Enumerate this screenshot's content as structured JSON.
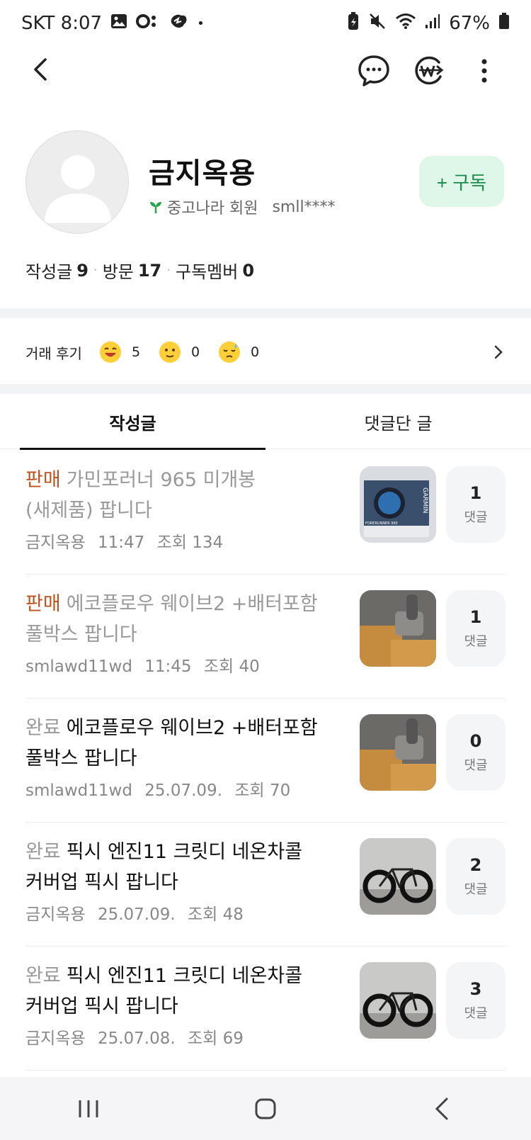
{
  "status_bar": {
    "carrier_time": "SKT 8:07",
    "dot": "•",
    "battery": "67%"
  },
  "profile": {
    "nickname": "금지옥용",
    "member_type": "중고나라 회원",
    "user_id": "smll****",
    "subscribe_label": "+ 구독",
    "stats": {
      "posts_label": "작성글",
      "posts_count": "9",
      "visits_label": "방문",
      "visits_count": "17",
      "subs_label": "구독멤버",
      "subs_count": "0"
    }
  },
  "reviews": {
    "label": "거래 후기",
    "good": "5",
    "neutral": "0",
    "bad": "0"
  },
  "tabs": [
    {
      "label": "작성글",
      "active": true
    },
    {
      "label": "댓글단 글",
      "active": false
    }
  ],
  "posts": [
    {
      "status": "판매",
      "title_line1": "가민포러너 965 미개봉",
      "title_line2": "(새제품) 팝니다",
      "author": "금지옥용",
      "time": "11:47",
      "views": "조회 134",
      "comments": "1",
      "comment_label": "댓글"
    },
    {
      "status": "판매",
      "title_line1": "에코플로우 웨이브2 +배터포함",
      "title_line2": "풀박스 팝니다",
      "author": "smlawd11wd",
      "time": "11:45",
      "views": "조회 40",
      "comments": "1",
      "comment_label": "댓글"
    },
    {
      "status": "완료",
      "title_line1": "에코플로우 웨이브2 +배터포함",
      "title_line2": "풀박스 팝니다",
      "author": "smlawd11wd",
      "time": "25.07.09.",
      "views": "조회 70",
      "comments": "0",
      "comment_label": "댓글"
    },
    {
      "status": "완료",
      "title_line1": "픽시 엔진11 크릿디 네온차콜",
      "title_line2": "커버업 픽시 팝니다",
      "author": "금지옥용",
      "time": "25.07.09.",
      "views": "조회 48",
      "comments": "2",
      "comment_label": "댓글"
    },
    {
      "status": "완료",
      "title_line1": "픽시 엔진11 크릿디 네온차콜",
      "title_line2": "커버업 픽시 팝니다",
      "author": "금지옥용",
      "time": "25.07.08.",
      "views": "조회 69",
      "comments": "3",
      "comment_label": "댓글"
    }
  ],
  "thumb_text": {
    "garmin_brand": "GARMIN",
    "garmin_model": "FORERUNNER 965"
  },
  "colors": {
    "sale": "#c0511c",
    "complete": "#999999",
    "subscribe_bg": "#dff7e8",
    "subscribe_fg": "#1a8a4a"
  }
}
